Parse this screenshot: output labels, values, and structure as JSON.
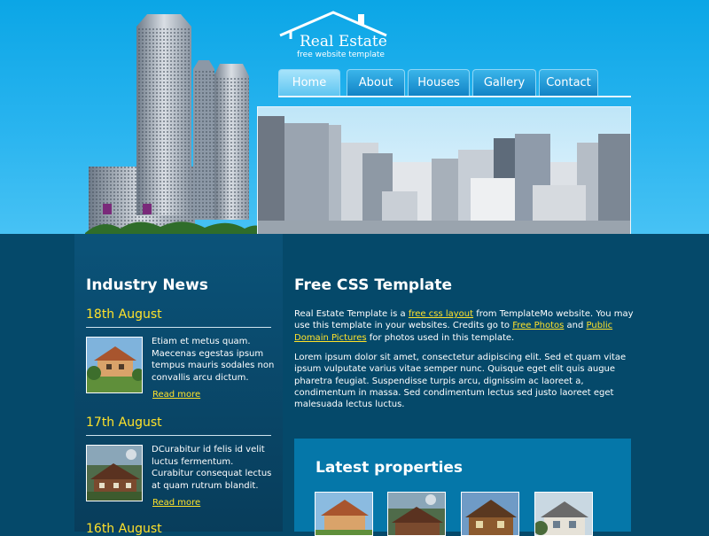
{
  "logo": {
    "title": "Real Estate",
    "tagline": "free website template"
  },
  "nav": {
    "tabs": [
      {
        "label": "Home"
      },
      {
        "label": "About"
      },
      {
        "label": "Houses"
      },
      {
        "label": "Gallery"
      },
      {
        "label": "Contact"
      }
    ],
    "active": "Home"
  },
  "sidebar": {
    "heading": "Industry News",
    "items": [
      {
        "date": "18th August",
        "text": "Etiam et metus quam. Maecenas egestas ipsum tempus mauris sodales non convallis arcu dictum.",
        "link": "Read more"
      },
      {
        "date": "17th August",
        "text": "DCurabitur id felis id velit luctus fermentum. Curabitur consequat lectus at quam rutrum blandit.",
        "link": "Read more"
      },
      {
        "date": "16th August"
      }
    ]
  },
  "main": {
    "heading": "Free CSS Template",
    "p1": {
      "t1": "Real Estate Template is a ",
      "link1": "free css layout",
      "t2": " from TemplateMo website. You may use this template in your websites. Credits go to ",
      "link2": "Free Photos",
      "t3": " and ",
      "link3": "Public Domain Pictures",
      "t4": " for photos used in this template."
    },
    "p2": "Lorem ipsum dolor sit amet, consectetur adipiscing elit. Sed et quam vitae ipsum vulputate varius vitae semper nunc. Quisque eget elit quis augue pharetra feugiat. Suspendisse turpis arcu, dignissim ac laoreet a, condimentum in massa. Sed condimentum lectus sed justo laoreet eget malesuada lectus luctus.",
    "properties_heading": "Latest properties"
  },
  "colors": {
    "header_top": "#0ba6e6",
    "body_bg": "#05496a",
    "sidebar_bg": "#0b5379",
    "accent": "#ffe22a",
    "properties_bg": "#0577a9"
  }
}
